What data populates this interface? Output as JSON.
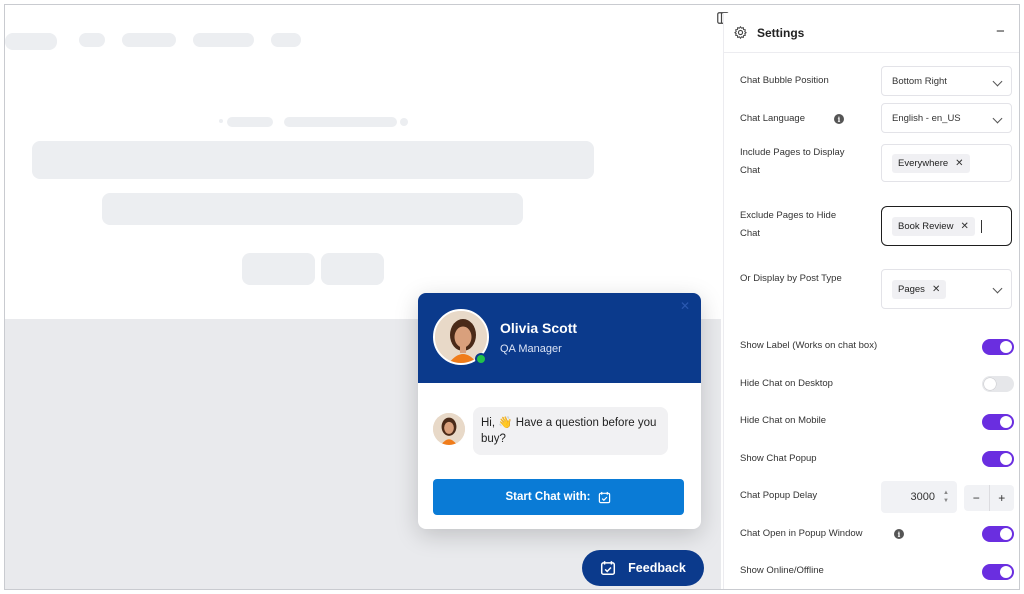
{
  "widget": {
    "agent_name": "Olivia Scott",
    "agent_role": "QA Manager",
    "greeting": "Hi, 👋 Have a question before you buy?",
    "start_chat_label": "Start Chat with:"
  },
  "feedback": {
    "label": "Feedback"
  },
  "settings": {
    "title": "Settings",
    "bubble_position": {
      "label": "Chat Bubble Position",
      "value": "Bottom Right"
    },
    "language": {
      "label": "Chat Language",
      "value": "English - en_US"
    },
    "include_pages": {
      "label_line1": "Include Pages to Display",
      "label_line2": "Chat",
      "chip": "Everywhere"
    },
    "exclude_pages": {
      "label_line1": "Exclude Pages to Hide",
      "label_line2": "Chat",
      "chip": "Book Review"
    },
    "post_type": {
      "label": "Or Display by Post Type",
      "chip": "Pages"
    },
    "show_label": {
      "label": "Show Label (Works on chat box)",
      "on": true
    },
    "hide_desktop": {
      "label": "Hide Chat on Desktop",
      "on": false
    },
    "hide_mobile": {
      "label": "Hide Chat on Mobile",
      "on": true
    },
    "show_popup": {
      "label": "Show Chat Popup",
      "on": true
    },
    "popup_delay": {
      "label": "Chat Popup Delay",
      "value": "3000",
      "minus": "−",
      "plus": "+"
    },
    "popup_window": {
      "label": "Chat Open in Popup Window",
      "on": true
    },
    "online_offline": {
      "label": "Show Online/Offline",
      "on": true
    }
  },
  "colors": {
    "header_blue": "#0b3a8c",
    "button_blue": "#0a7bd6",
    "toggle_on": "#6a2ee0",
    "online_green": "#21c24a"
  }
}
